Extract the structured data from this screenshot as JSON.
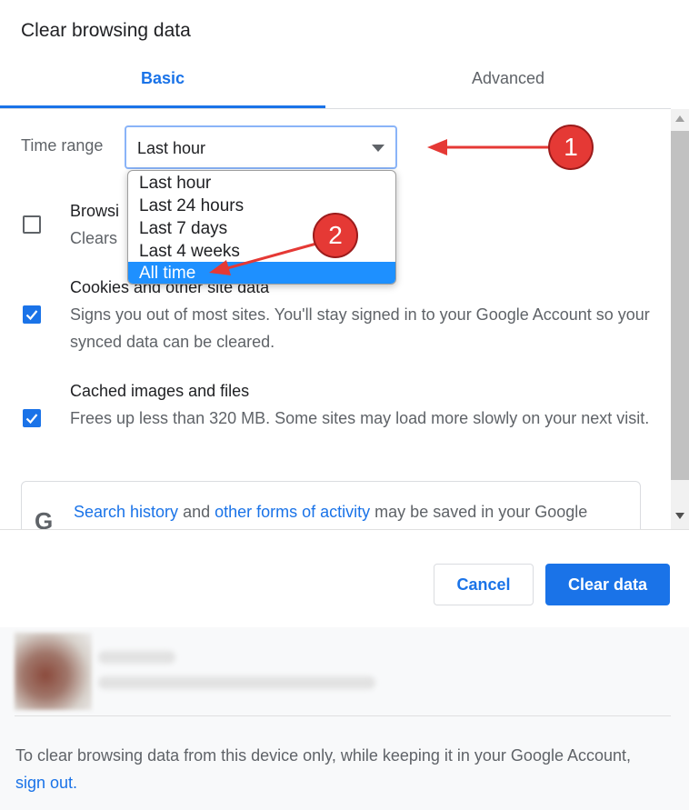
{
  "dialog": {
    "title": "Clear browsing data"
  },
  "tabs": [
    {
      "label": "Basic"
    },
    {
      "label": "Advanced"
    }
  ],
  "time_range": {
    "label": "Time range",
    "selected": "Last hour",
    "options": [
      "Last hour",
      "Last 24 hours",
      "Last 7 days",
      "Last 4 weeks",
      "All time"
    ],
    "highlighted_index": 4
  },
  "items": [
    {
      "title": "Browsi",
      "desc": "Clears",
      "checked": false
    },
    {
      "title": "Cookies and other site data",
      "desc": "Signs you out of most sites. You'll stay signed in to your Google Account so your synced data can be cleared.",
      "checked": true
    },
    {
      "title": "Cached images and files",
      "desc": "Frees up less than 320 MB. Some sites may load more slowly on your next visit.",
      "checked": true
    }
  ],
  "google_notice": {
    "icon": "G",
    "link1": "Search history",
    "and": " and ",
    "link2": "other forms of activity",
    "rest": " may be saved in your Google"
  },
  "buttons": {
    "cancel": "Cancel",
    "clear": "Clear data"
  },
  "account_note": {
    "text": "To clear browsing data from this device only, while keeping it in your Google Account, ",
    "link": "sign out."
  },
  "annotations": {
    "badge1": "1",
    "badge2": "2",
    "color": "#e53935"
  },
  "colors": {
    "accent": "#1a73e8",
    "highlight": "#1e90ff"
  }
}
